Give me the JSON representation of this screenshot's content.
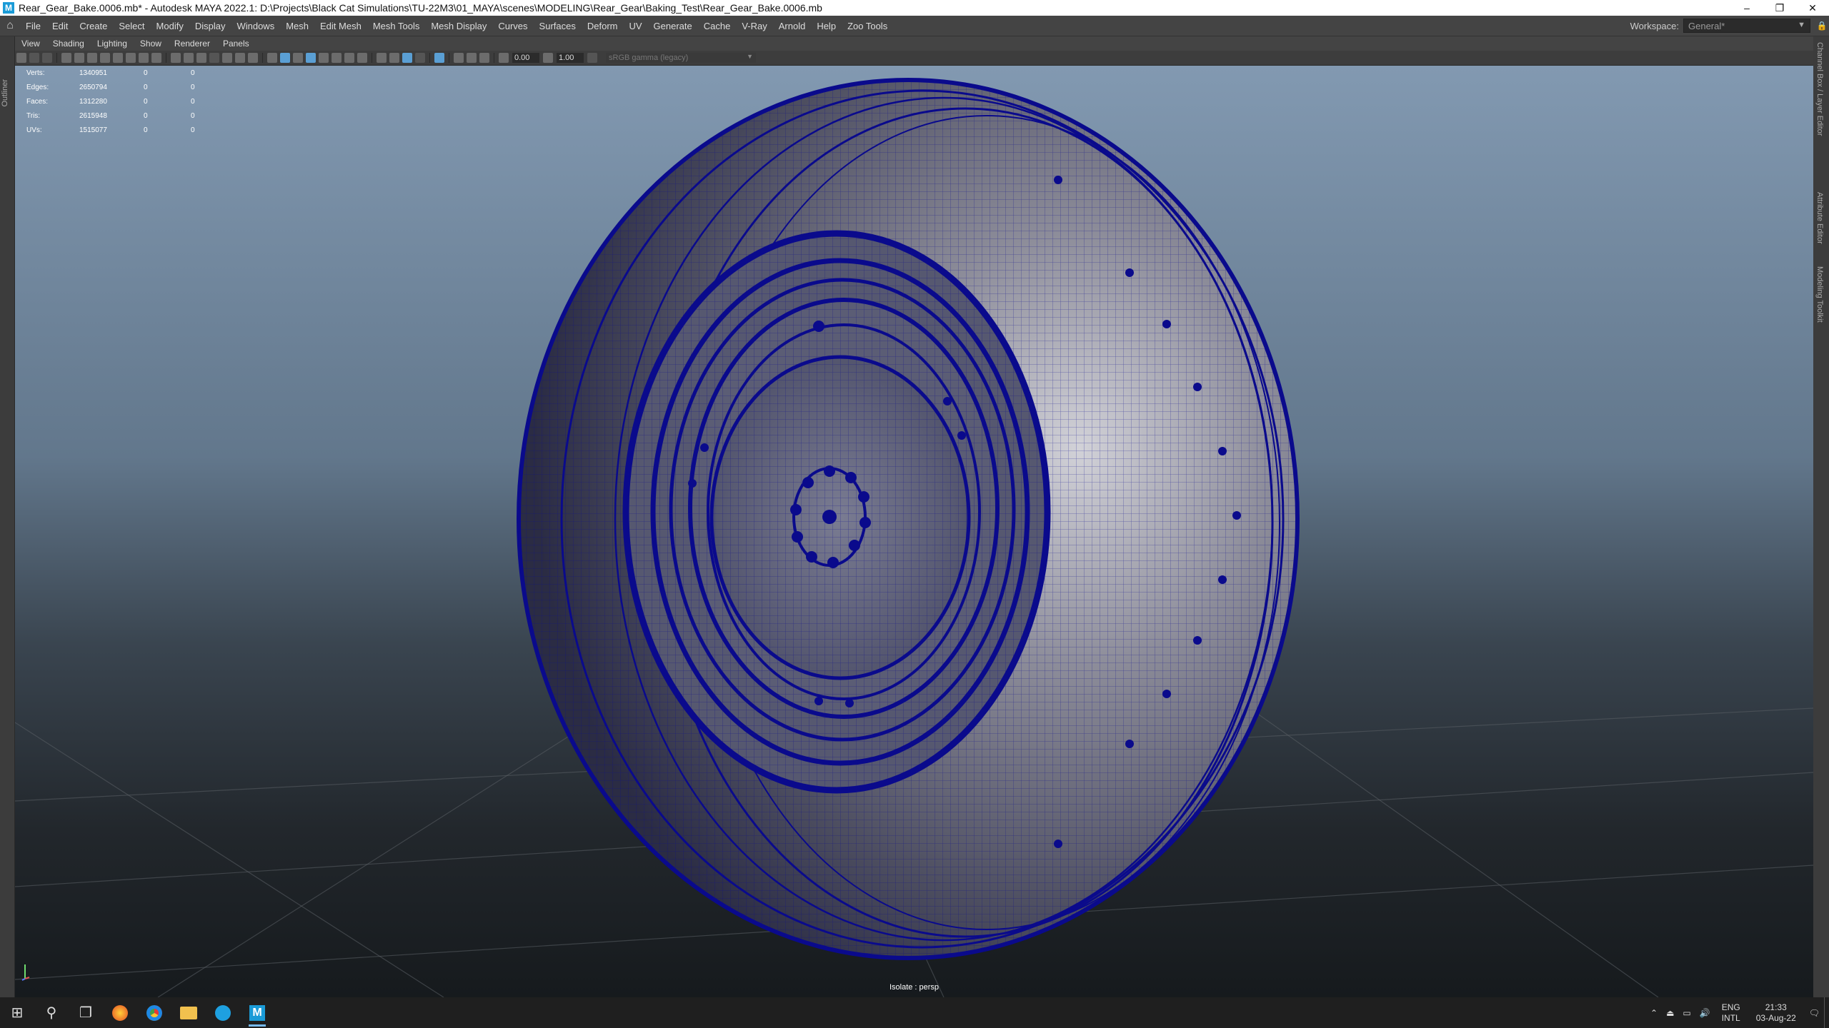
{
  "window": {
    "title": "Rear_Gear_Bake.0006.mb* - Autodesk MAYA 2022.1: D:\\Projects\\Black Cat Simulations\\TU-22M3\\01_MAYA\\scenes\\MODELING\\Rear_Gear\\Baking_Test\\Rear_Gear_Bake.0006.mb",
    "app_icon": "M",
    "minimize": "–",
    "restore": "❐",
    "close": "✕"
  },
  "menubar": {
    "items": [
      "File",
      "Edit",
      "Create",
      "Select",
      "Modify",
      "Display",
      "Windows",
      "Mesh",
      "Edit Mesh",
      "Mesh Tools",
      "Mesh Display",
      "Curves",
      "Surfaces",
      "Deform",
      "UV",
      "Generate",
      "Cache",
      "V-Ray",
      "Arnold",
      "Help",
      "Zoo Tools"
    ],
    "workspace_label": "Workspace:",
    "workspace_value": "General*"
  },
  "left_strip": {
    "label": "Outliner"
  },
  "right_strip": {
    "tabs": [
      "Channel Box / Layer Editor",
      "Attribute Editor",
      "Modeling Toolkit"
    ]
  },
  "panel_menu": {
    "items": [
      "View",
      "Shading",
      "Lighting",
      "Show",
      "Renderer",
      "Panels"
    ]
  },
  "toolbar": {
    "exposure": "0.00",
    "gamma": "1.00",
    "color_space": "sRGB gamma (legacy)"
  },
  "hud": {
    "rows": [
      {
        "label": "Verts:",
        "v1": "1340951",
        "v2": "0",
        "v3": "0"
      },
      {
        "label": "Edges:",
        "v1": "2650794",
        "v2": "0",
        "v3": "0"
      },
      {
        "label": "Faces:",
        "v1": "1312280",
        "v2": "0",
        "v3": "0"
      },
      {
        "label": "Tris:",
        "v1": "2615948",
        "v2": "0",
        "v3": "0"
      },
      {
        "label": "UVs:",
        "v1": "1515077",
        "v2": "0",
        "v3": "0"
      }
    ]
  },
  "viewport": {
    "camera_label": "Isolate : persp"
  },
  "taskbar": {
    "language": "ENG",
    "layout": "INTL",
    "time": "21:33",
    "date": "03-Aug-22"
  },
  "colors": {
    "wire": "#0a0a8c",
    "menu_bg": "#444444",
    "highlight": "#5a9fd4"
  }
}
